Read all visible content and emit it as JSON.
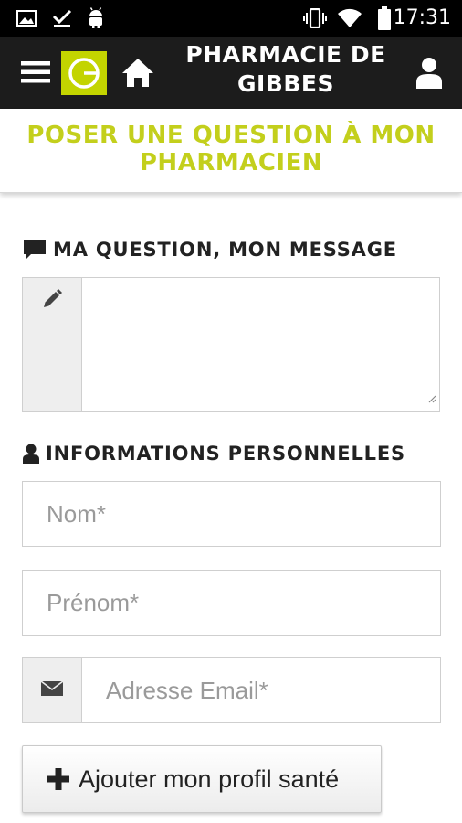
{
  "status_bar": {
    "time": "17:31",
    "icons": [
      "gallery-icon",
      "check-icon",
      "android-icon",
      "vibrate-icon",
      "wifi-icon",
      "battery-icon"
    ]
  },
  "header": {
    "title_line1": "PHARMACIE DE",
    "title_line2": "GIBBES",
    "logo_color": "#c3d400",
    "icons": [
      "menu-icon",
      "logo",
      "home-icon",
      "user-icon"
    ]
  },
  "page": {
    "heading_line1": "POSER UNE QUESTION À MON",
    "heading_line2": "PHARMACIEN",
    "accent_color": "#c3cf1c"
  },
  "message_section": {
    "label": "MA QUESTION, MON MESSAGE",
    "icon": "comment-icon",
    "textarea_value": "",
    "addon_icon": "pencil-icon"
  },
  "personal_section": {
    "label": "INFORMATIONS PERSONNELLES",
    "icon": "user-icon",
    "fields": [
      {
        "placeholder": "Nom*",
        "value": ""
      },
      {
        "placeholder": "Prénom*",
        "value": ""
      },
      {
        "placeholder": "Adresse Email*",
        "value": "",
        "addon_icon": "envelope-icon"
      }
    ]
  },
  "actions": {
    "add_profile_label": "Ajouter mon profil santé",
    "add_profile_icon": "plus-icon"
  }
}
